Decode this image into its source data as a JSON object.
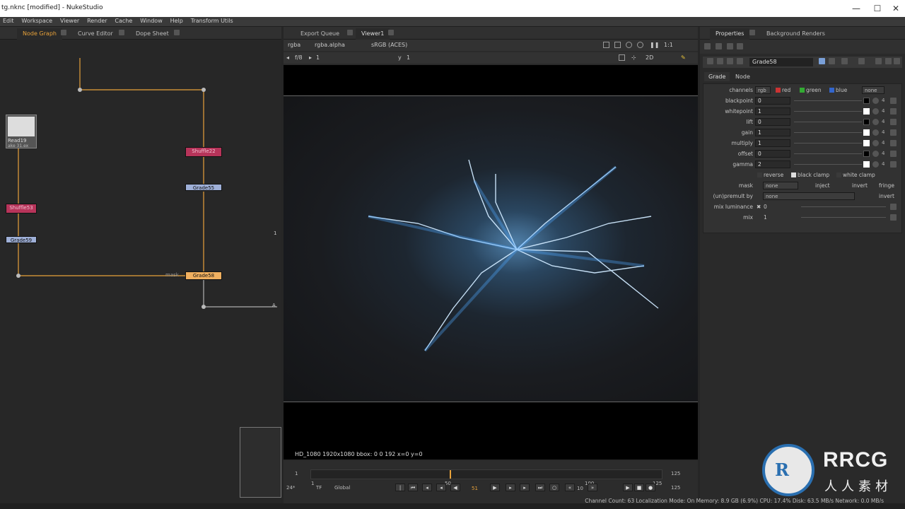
{
  "window": {
    "title": "tg.nknc [modified] - NukeStudio",
    "minimize": "—",
    "maximize": "☐",
    "close": "✕"
  },
  "menu": [
    "Edit",
    "Workspace",
    "Viewer",
    "Render",
    "Cache",
    "Window",
    "Help",
    "Transform Utils"
  ],
  "left_panel": {
    "tabs": [
      "Node Graph",
      "Curve Editor",
      "Dope Sheet"
    ],
    "nodes": {
      "read": "Read19",
      "read_sub": "ake 31.ex",
      "shuffle_top": "Shuffle22",
      "grade_top": "Grade55",
      "shuffle_left": "Shuffle53",
      "grade_left": "Grade59",
      "grade_sel": "Grade58"
    },
    "mask_label": "mask",
    "a_label": "A",
    "one_label": "1"
  },
  "viewer": {
    "tabs": [
      "Export Queue",
      "Viewer1"
    ],
    "channels": "rgba",
    "alpha": "rgba.alpha",
    "lut": "sRGB (ACES)",
    "zoom": "1:1",
    "mode": "2D",
    "fstop": "f/8",
    "frame_left": "1",
    "y_label": "y",
    "y_value": "1",
    "status": "HD_1080 1920x1080  bbox: 0 0 192  x=0 y=0",
    "timeline": {
      "start": "1",
      "mark50": "50",
      "mark100": "100",
      "end": "125",
      "in": "1",
      "out": "125",
      "current": "51",
      "step": "10",
      "fps": "24*",
      "tf": "TF",
      "global": "Global"
    }
  },
  "properties": {
    "tabs": [
      "Properties",
      "Background Renders"
    ],
    "node_name": "Grade58",
    "subtabs": [
      "Grade",
      "Node"
    ],
    "channels": {
      "label": "channels",
      "value": "rgb",
      "red": "red",
      "green": "green",
      "blue": "blue",
      "none": "none"
    },
    "params": [
      {
        "label": "blackpoint",
        "value": "0"
      },
      {
        "label": "whitepoint",
        "value": "1"
      },
      {
        "label": "lift",
        "value": "0"
      },
      {
        "label": "gain",
        "value": "1"
      },
      {
        "label": "multiply",
        "value": "1"
      },
      {
        "label": "offset",
        "value": "0"
      },
      {
        "label": "gamma",
        "value": "2"
      }
    ],
    "four": "4",
    "reverse": "reverse",
    "black_clamp": "black clamp",
    "white_clamp": "white clamp",
    "mask": {
      "label": "mask",
      "value": "none",
      "inject": "inject",
      "invert": "invert",
      "fringe": "fringe"
    },
    "unpremult": {
      "label": "(un)premult by",
      "value": "none",
      "invert": "invert"
    },
    "mix_luminance": {
      "label": "mix luminance",
      "value": "0"
    },
    "mix": {
      "label": "mix",
      "value": "1"
    }
  },
  "statusbar": "Channel Count: 63  Localization Mode: On  Memory: 8.9 GB (6.9%)  CPU: 17.4%  Disk: 63.5 MB/s  Network: 0.0 MB/s",
  "watermark": {
    "big": "RRCG",
    "cn": "人人素材",
    "ring": "R"
  }
}
